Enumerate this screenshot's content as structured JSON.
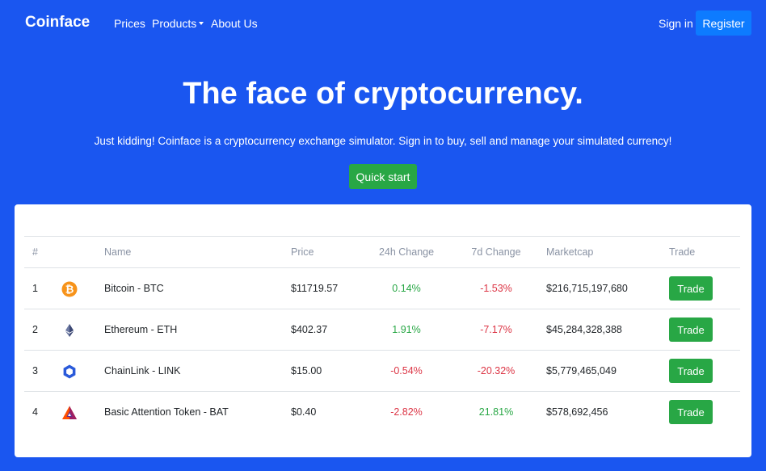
{
  "navbar": {
    "brand": "Coinface",
    "links": [
      "Prices",
      "Products",
      "About Us"
    ],
    "sign_in": "Sign in",
    "register": "Register"
  },
  "hero": {
    "title": "The face of cryptocurrency.",
    "subtitle": "Just kidding! Coinface is a cryptocurrency exchange simulator. Sign in to buy, sell and manage your simulated currency!",
    "cta": "Quick start"
  },
  "table": {
    "headers": {
      "rank": "#",
      "name": "Name",
      "price": "Price",
      "change_24h": "24h Change",
      "change_7d": "7d Change",
      "marketcap": "Marketcap",
      "trade": "Trade"
    },
    "rows": [
      {
        "rank": "1",
        "icon": "bitcoin-icon",
        "name": "Bitcoin - BTC",
        "price": "$11719.57",
        "change_24h": "0.14%",
        "change_7d": "-1.53%",
        "marketcap": "$216,715,197,680",
        "trade": "Trade"
      },
      {
        "rank": "2",
        "icon": "ethereum-icon",
        "name": "Ethereum - ETH",
        "price": "$402.37",
        "change_24h": "1.91%",
        "change_7d": "-7.17%",
        "marketcap": "$45,284,328,388",
        "trade": "Trade"
      },
      {
        "rank": "3",
        "icon": "chainlink-icon",
        "name": "ChainLink - LINK",
        "price": "$15.00",
        "change_24h": "-0.54%",
        "change_7d": "-20.32%",
        "marketcap": "$5,779,465,049",
        "trade": "Trade"
      },
      {
        "rank": "4",
        "icon": "basic-attention-token-icon",
        "name": "Basic Attention Token - BAT",
        "price": "$0.40",
        "change_24h": "-2.82%",
        "change_7d": "21.81%",
        "marketcap": "$578,692,456",
        "trade": "Trade"
      }
    ]
  },
  "colors": {
    "background": "#1a56f0",
    "register_button": "#0d7bff",
    "positive": "#28a745",
    "negative": "#dc3545",
    "trade_button": "#28a745"
  }
}
